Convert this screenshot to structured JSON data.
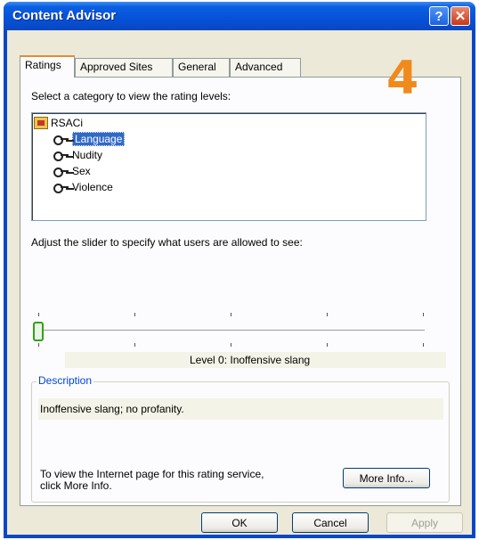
{
  "window": {
    "title": "Content Advisor",
    "help_glyph": "?",
    "close_glyph": "✕"
  },
  "tabs": [
    {
      "label": "Ratings",
      "active": true
    },
    {
      "label": "Approved Sites"
    },
    {
      "label": "General"
    },
    {
      "label": "Advanced"
    }
  ],
  "annotation": {
    "step": "4",
    "color": "#f08a1c"
  },
  "ratings": {
    "category_prompt": "Select a category to view the rating levels:",
    "tree": {
      "root": "RSACi",
      "items": [
        "Language",
        "Nudity",
        "Sex",
        "Violence"
      ],
      "selected": "Language"
    },
    "slider_prompt": "Adjust the slider to specify what users are allowed to see:",
    "slider_level_index": 0,
    "level_text": "Level 0:  Inoffensive slang",
    "description_title": "Description",
    "description_text": "Inoffensive slang; no profanity.",
    "info_line1": "To view the Internet page for this rating service,",
    "info_line2": "click More Info.",
    "more_info_button": "More Info..."
  },
  "buttons": {
    "ok": "OK",
    "cancel": "Cancel",
    "apply": "Apply"
  }
}
